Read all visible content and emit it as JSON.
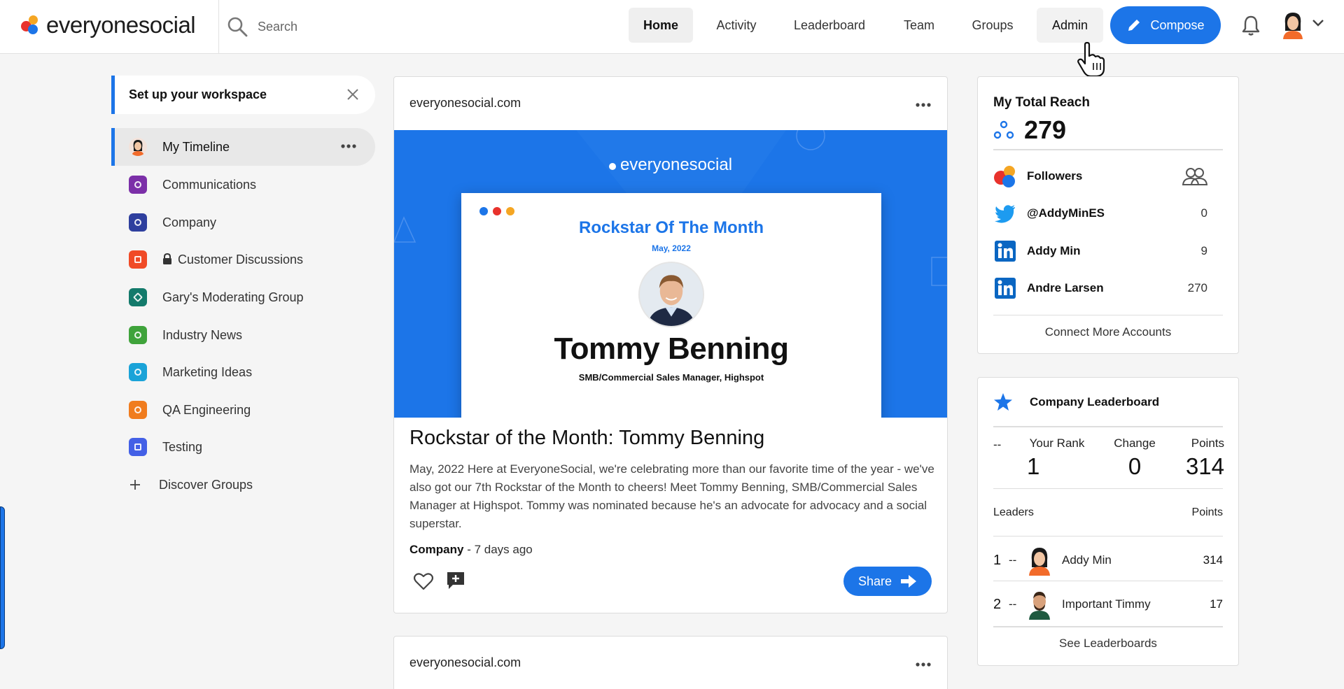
{
  "brand": {
    "name": "everyonesocial",
    "accent": "#1c75e8"
  },
  "search": {
    "placeholder": "Search"
  },
  "nav": {
    "items": [
      {
        "label": "Home",
        "active": true
      },
      {
        "label": "Activity"
      },
      {
        "label": "Leaderboard"
      },
      {
        "label": "Team"
      },
      {
        "label": "Groups"
      },
      {
        "label": "Admin",
        "hover": true
      }
    ],
    "compose_label": "Compose"
  },
  "sidebar": {
    "setup_label": "Set up your workspace",
    "items": [
      {
        "label": "My Timeline",
        "color": "#f0d5c8",
        "active": true
      },
      {
        "label": "Communications",
        "color": "#7b2fa8"
      },
      {
        "label": "Company",
        "color": "#2e3f9e"
      },
      {
        "label": "Customer Discussions",
        "color": "#f04a26",
        "locked": true
      },
      {
        "label": "Gary's Moderating Group",
        "color": "#137a6b"
      },
      {
        "label": "Industry News",
        "color": "#3fa33b"
      },
      {
        "label": "Marketing Ideas",
        "color": "#1aa3d8"
      },
      {
        "label": "QA Engineering",
        "color": "#f07c1e"
      },
      {
        "label": "Testing",
        "color": "#4360e6"
      }
    ],
    "discover_label": "Discover Groups"
  },
  "post": {
    "domain": "everyonesocial.com",
    "hero": {
      "brand": "everyonesocial",
      "heading": "Rockstar Of The Month",
      "date": "May, 2022",
      "name": "Tommy Benning",
      "role": "SMB/Commercial Sales Manager, Highspot"
    },
    "title": "Rockstar of the Month: Tommy Benning",
    "body": "May, 2022 Here at EveryoneSocial, we're celebrating more than our favorite time of the year - we've also got our 7th Rockstar of the Month to cheers! Meet Tommy Benning, SMB/Commercial Sales Manager at Highspot. Tommy was nominated because he's an advocate for advocacy and a social superstar.",
    "group": "Company",
    "age": " - 7 days ago",
    "share_label": "Share"
  },
  "post2": {
    "domain": "everyonesocial.com"
  },
  "reach": {
    "title": "My Total Reach",
    "total": "279",
    "followers_label": "Followers",
    "accounts": [
      {
        "network": "twitter",
        "handle": "@AddyMinES",
        "count": "0"
      },
      {
        "network": "linkedin",
        "handle": "Addy Min",
        "count": "9"
      },
      {
        "network": "linkedin",
        "handle": "Andre Larsen",
        "count": "270"
      }
    ],
    "connect_label": "Connect More Accounts"
  },
  "leaderboard": {
    "title": "Company Leaderboard",
    "dash": "--",
    "your_rank_label": "Your Rank",
    "your_rank": "1",
    "change_label": "Change",
    "change": "0",
    "points_label": "Points",
    "points": "314",
    "leaders_label": "Leaders",
    "points_col_label": "Points",
    "leaders": [
      {
        "rank": "1",
        "change": "--",
        "name": "Addy Min",
        "points": "314"
      },
      {
        "rank": "2",
        "change": "--",
        "name": "Important Timmy",
        "points": "17"
      }
    ],
    "see_label": "See Leaderboards"
  }
}
